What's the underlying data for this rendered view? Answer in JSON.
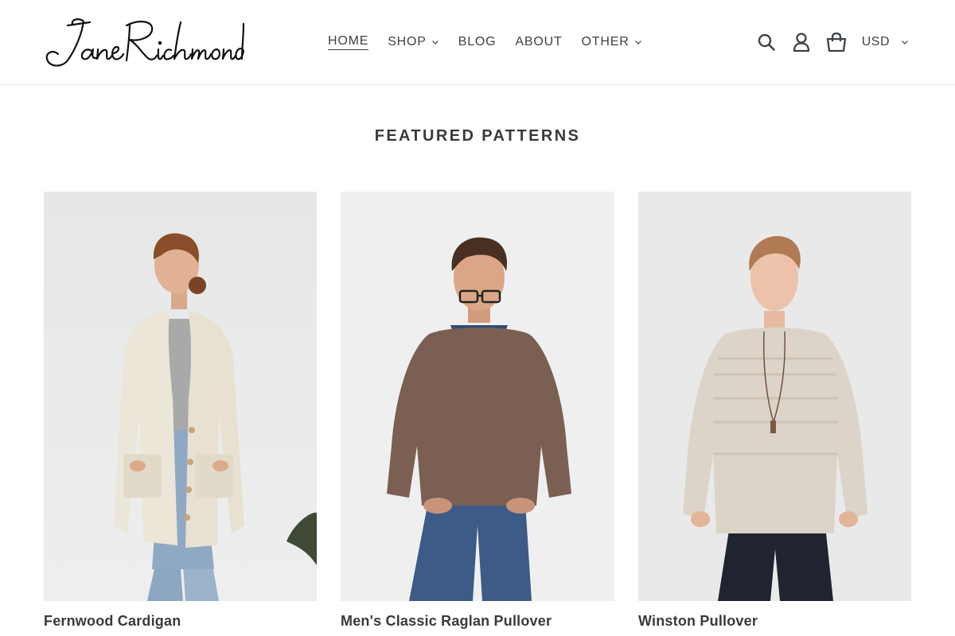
{
  "brand": {
    "name": "Jane Richmond",
    "logo_icon": "script-wordmark-logo"
  },
  "nav": {
    "items": [
      {
        "label": "HOME",
        "active": true,
        "has_dropdown": false
      },
      {
        "label": "SHOP",
        "active": false,
        "has_dropdown": true
      },
      {
        "label": "BLOG",
        "active": false,
        "has_dropdown": false
      },
      {
        "label": "ABOUT",
        "active": false,
        "has_dropdown": false
      },
      {
        "label": "OTHER",
        "active": false,
        "has_dropdown": true
      }
    ]
  },
  "header_icons": {
    "search": "search-icon",
    "account": "user-icon",
    "cart": "cart-icon"
  },
  "currency": {
    "selected": "USD"
  },
  "featured": {
    "title": "FEATURED PATTERNS",
    "products": [
      {
        "title": "Fernwood Cardigan",
        "image": "woman-cream-cardigan-photo"
      },
      {
        "title": "Men's Classic Raglan Pullover",
        "image": "man-brown-raglan-sweater-photo"
      },
      {
        "title": "Winston Pullover",
        "image": "woman-oatmeal-pullover-photo"
      }
    ]
  },
  "colors": {
    "text": "#3a3a3a",
    "nav_text": "#3d4246",
    "border": "#e8e8e8",
    "background": "#ffffff"
  }
}
